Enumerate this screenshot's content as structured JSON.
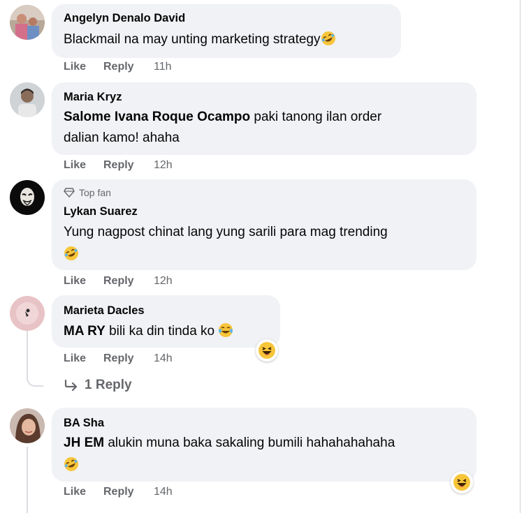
{
  "actions": {
    "like": "Like",
    "reply": "Reply"
  },
  "comments": [
    {
      "author": "Angelyn Denalo David",
      "text": "Blackmail na may unting marketing strategy",
      "time": "11h",
      "emoji": "rolling-on-floor-laughing"
    },
    {
      "author": "Maria Kryz",
      "mention": "Salome Ivana Roque Ocampo",
      "text": " paki tanong ilan order",
      "text2": "dalian kamo! ahaha",
      "time": "12h"
    },
    {
      "badge": "Top fan",
      "author": "Lykan Suarez",
      "text": "Yung nagpost chinat lang yung sarili para mag trending",
      "time": "12h",
      "emoji": "rolling-on-floor-laughing"
    },
    {
      "author": "Marieta Dacles",
      "mention": "MA RY",
      "text": " bili ka din tinda ko",
      "time": "14h",
      "emoji": "face-with-tears-of-joy",
      "reaction": "haha-reaction",
      "replies": "1 Reply"
    },
    {
      "author": "BA Sha",
      "mention": "JH EM",
      "text": " alukin muna baka sakaling bumili hahahahahaha",
      "time": "14h",
      "emoji": "rolling-on-floor-laughing",
      "reaction": "haha-reaction"
    }
  ]
}
